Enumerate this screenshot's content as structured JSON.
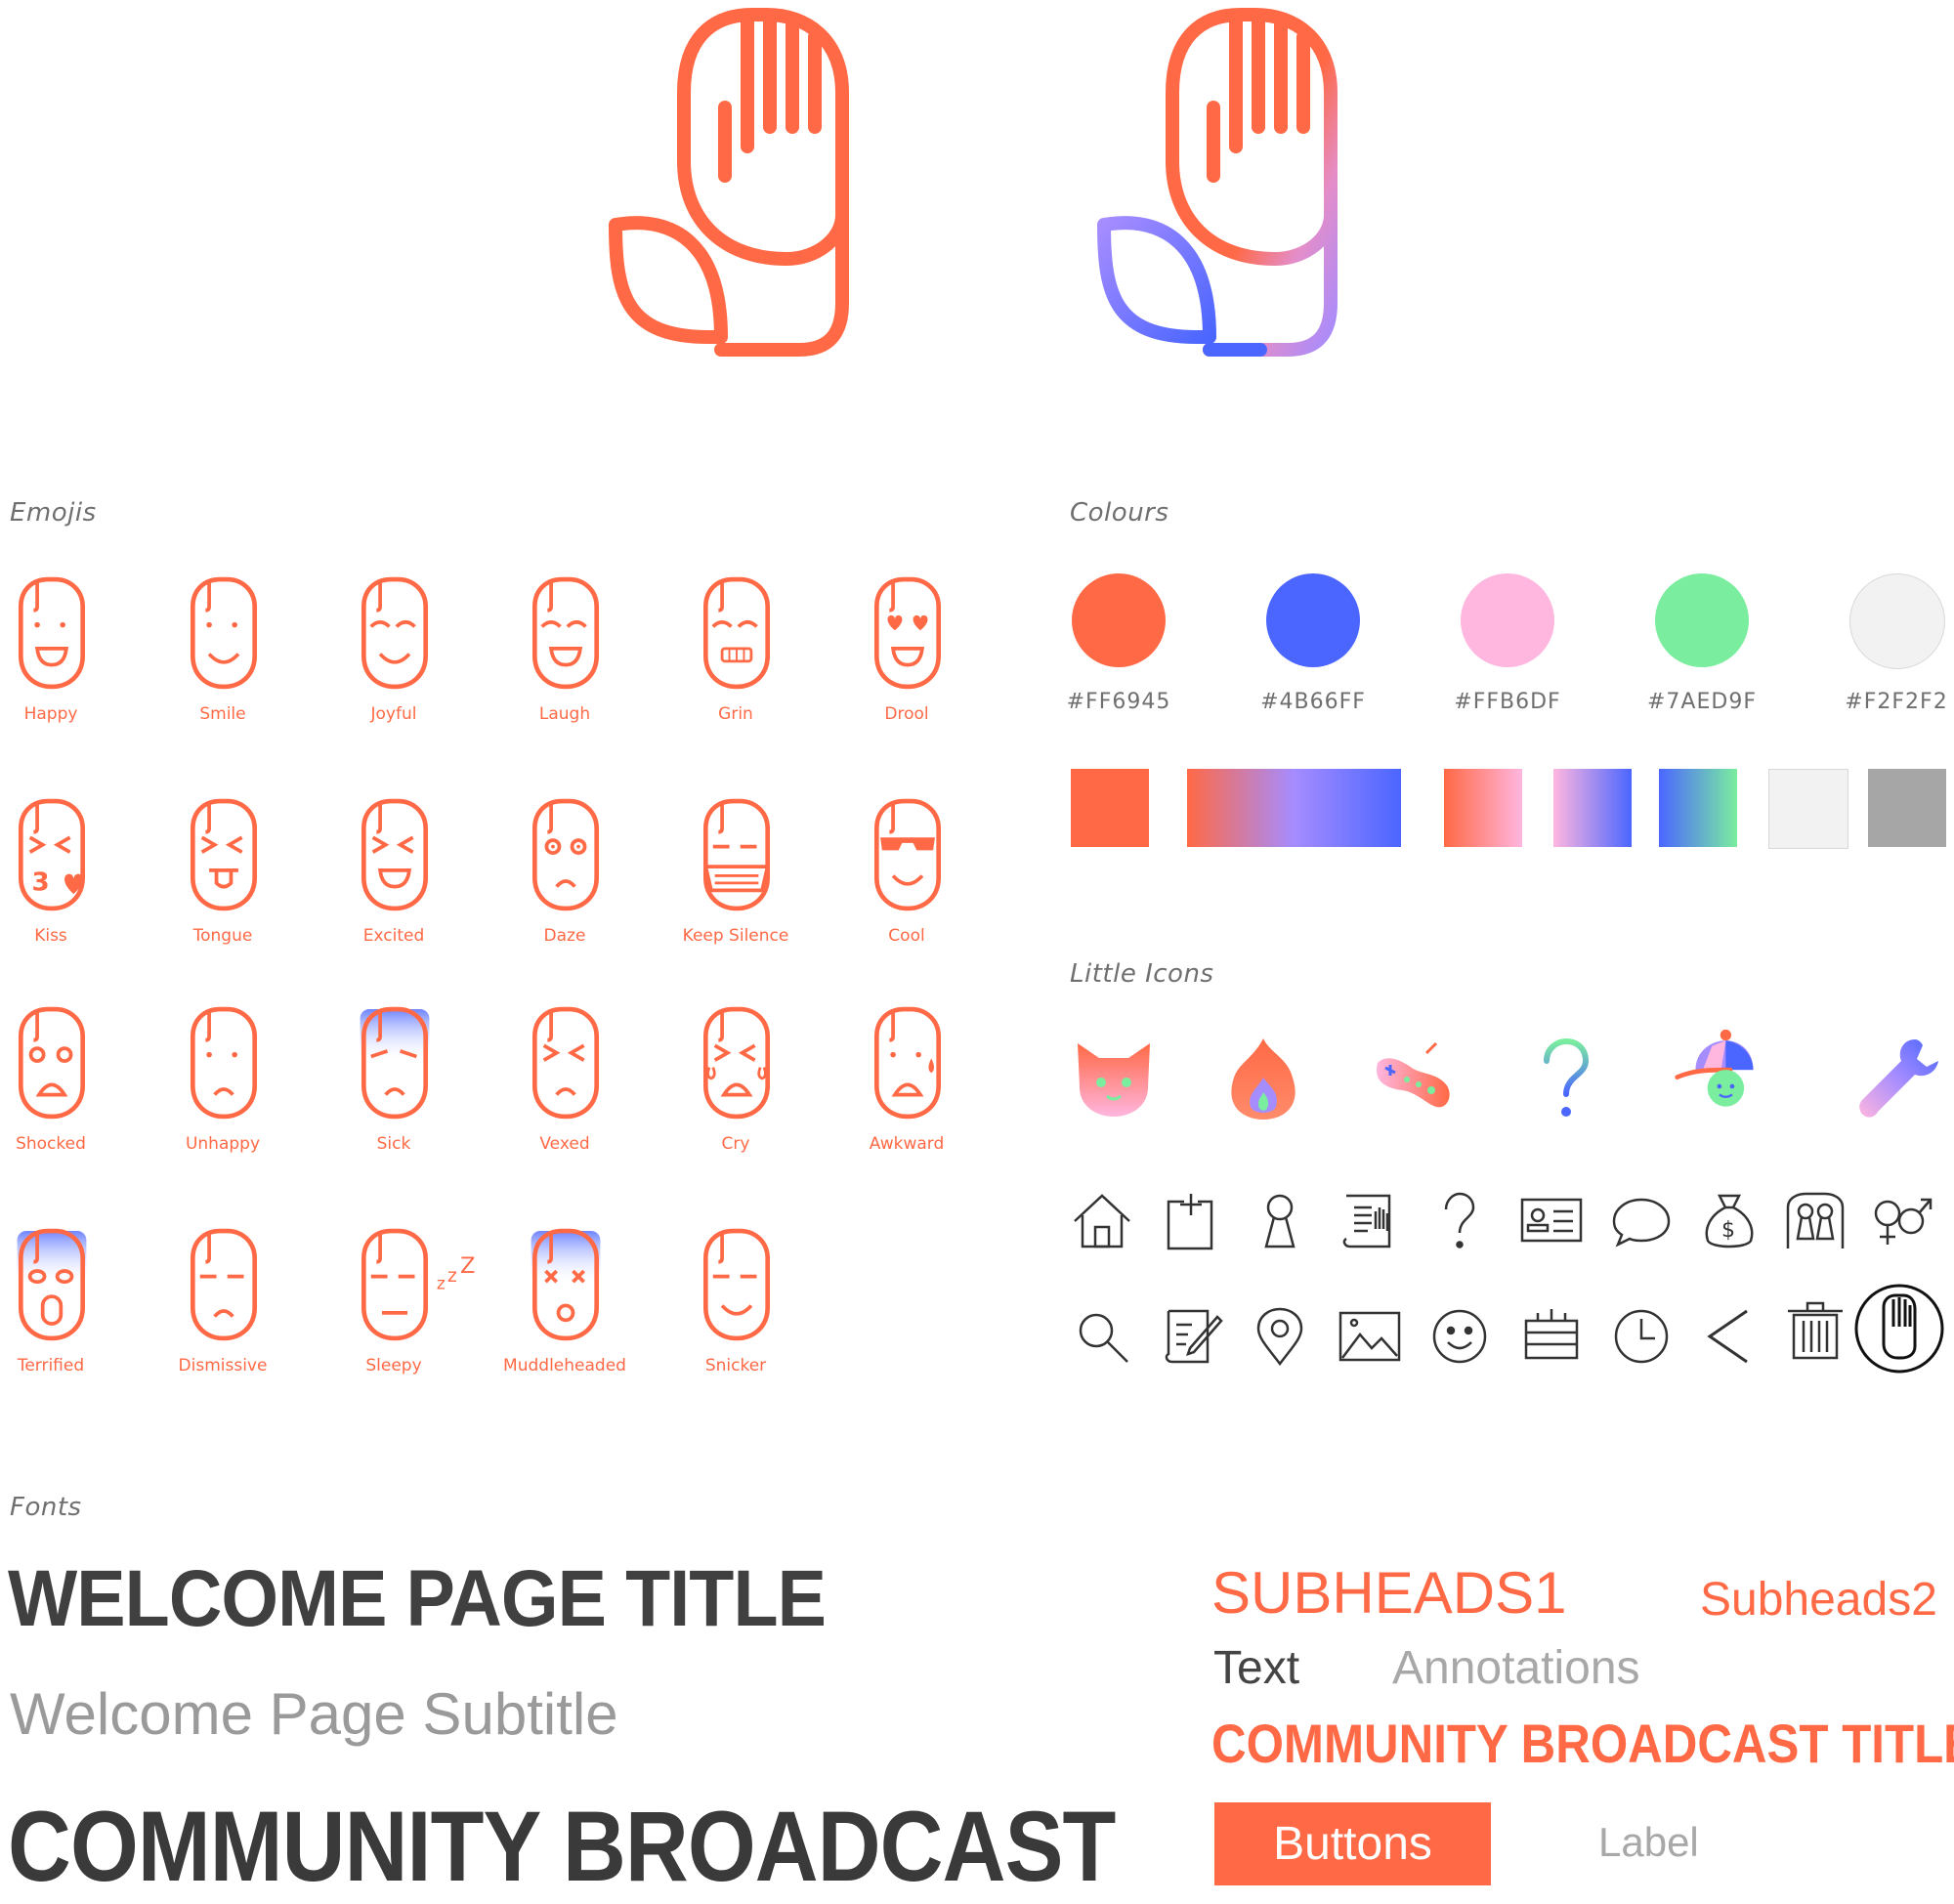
{
  "sections": {
    "emojis": "Emojis",
    "colours": "Colours",
    "little_icons": "Little Icons",
    "fonts": "Fonts"
  },
  "emojis": [
    {
      "label": "Happy"
    },
    {
      "label": "Smile"
    },
    {
      "label": "Joyful"
    },
    {
      "label": "Laugh"
    },
    {
      "label": "Grin"
    },
    {
      "label": "Drool"
    },
    {
      "label": "Kiss"
    },
    {
      "label": "Tongue"
    },
    {
      "label": "Excited"
    },
    {
      "label": "Daze"
    },
    {
      "label": "Keep Silence"
    },
    {
      "label": "Cool"
    },
    {
      "label": "Shocked"
    },
    {
      "label": "Unhappy"
    },
    {
      "label": "Sick"
    },
    {
      "label": "Vexed"
    },
    {
      "label": "Cry"
    },
    {
      "label": "Awkward"
    },
    {
      "label": "Terrified"
    },
    {
      "label": "Dismissive"
    },
    {
      "label": "Sleepy"
    },
    {
      "label": "Muddleheaded"
    },
    {
      "label": "Snicker"
    }
  ],
  "colours": [
    {
      "hex_label": "#FF6945",
      "color": "#FF6945"
    },
    {
      "hex_label": "#4B66FF",
      "color": "#4B66FF"
    },
    {
      "hex_label": "#FFB6DF",
      "color": "#FFB6DF"
    },
    {
      "hex_label": "#7AED9F",
      "color": "#7AED9F"
    },
    {
      "hex_label": "#F2F2F2",
      "color": "#F2F2F2"
    }
  ],
  "gradients": [
    {
      "name": "solid-orange",
      "colors": [
        "#FF6945",
        "#FF6945"
      ]
    },
    {
      "name": "orange-to-blue",
      "colors": [
        "#FF6945",
        "#A58CFF",
        "#4B66FF"
      ]
    },
    {
      "name": "orange-to-pink",
      "colors": [
        "#FF6945",
        "#FFB6DF"
      ]
    },
    {
      "name": "pink-to-blue",
      "colors": [
        "#FFB6DF",
        "#4B66FF"
      ]
    },
    {
      "name": "blue-to-green",
      "colors": [
        "#4B66FF",
        "#7AED9F"
      ]
    },
    {
      "name": "light-grey",
      "colors": [
        "#F2F2F2",
        "#F2F2F2"
      ]
    },
    {
      "name": "dark-grey",
      "colors": [
        "#A6A6A6",
        "#A6A6A6"
      ]
    }
  ],
  "colour_icons": [
    "cat-icon",
    "fire-icon",
    "gamepad-icon",
    "question-icon",
    "cap-kid-icon",
    "wrench-icon"
  ],
  "line_icons_row1": [
    "home-icon",
    "add-page-icon",
    "keyhole-icon",
    "document-hand-icon",
    "question-mark-icon",
    "id-card-icon",
    "chat-bubble-icon",
    "money-bag-icon",
    "lock-people-icon",
    "gender-icon"
  ],
  "line_icons_row2": [
    "search-icon",
    "edit-note-icon",
    "location-pin-icon",
    "image-icon",
    "smiley-icon",
    "cake-icon",
    "clock-icon",
    "back-arrow-icon",
    "trash-icon",
    "hand-circle-icon"
  ],
  "fonts": {
    "welcome_title": "WELCOME PAGE TITLE",
    "welcome_subtitle": "Welcome Page Subtitle",
    "community": "COMMUNITY BROADCAST",
    "subheads1": "SUBHEADS1",
    "subheads2": "Subheads2",
    "text": "Text",
    "annotations": "Annotations",
    "community_title": "COMMUNITY BROADCAST TITLE",
    "button": "Buttons",
    "label": "Label"
  },
  "brand": {
    "primary": "#FF6945",
    "secondary": "#4B66FF"
  }
}
